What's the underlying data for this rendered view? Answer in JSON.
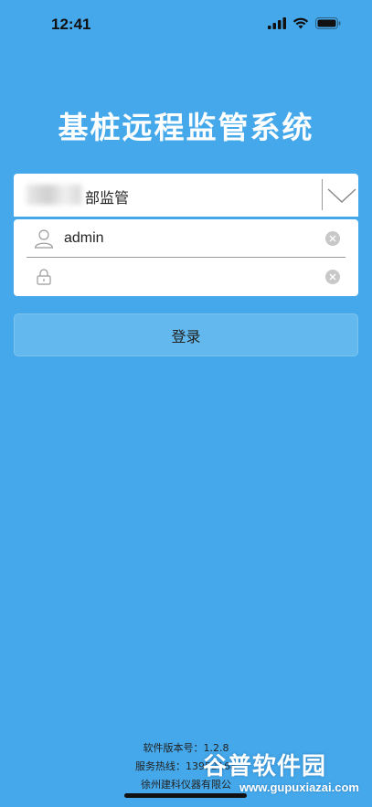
{
  "status_bar": {
    "time": "12:41"
  },
  "app_title": "基桩远程监管系统",
  "org_select": {
    "value": "部监管"
  },
  "login": {
    "username_value": "admin",
    "password_value": ""
  },
  "login_button": {
    "label": "登录"
  },
  "footer": {
    "version": "软件版本号：1.2.8",
    "hotline": "服务热线：13952168",
    "company": "徐州建科仪器有限公"
  },
  "watermark": {
    "main": "谷普软件园",
    "url": "www.gupuxiazai.com"
  },
  "colors": {
    "background": "#45a8ea",
    "button": "#63b9ee",
    "card": "#ffffff"
  },
  "icons": [
    "signal-icon",
    "wifi-icon",
    "battery-icon",
    "chevron-down-icon",
    "user-icon",
    "lock-icon",
    "clear-icon"
  ]
}
